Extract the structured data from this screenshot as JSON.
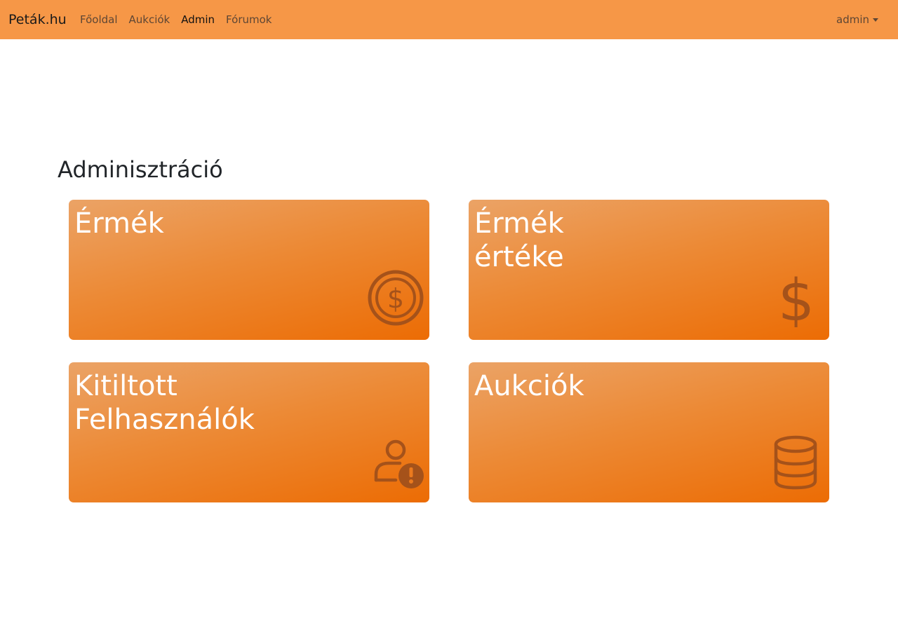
{
  "navbar": {
    "brand": "Peták.hu",
    "links": [
      {
        "label": "Főoldal",
        "active": false
      },
      {
        "label": "Aukciók",
        "active": false
      },
      {
        "label": "Admin",
        "active": true
      },
      {
        "label": "Fórumok",
        "active": false
      }
    ],
    "user": "admin"
  },
  "page": {
    "title": "Adminisztráció"
  },
  "cards": [
    {
      "title": "Érmék",
      "icon": "coin-icon"
    },
    {
      "title": "Érmék\nértéke",
      "icon": "dollar-icon"
    },
    {
      "title": "Kitiltott\nFelhasználók",
      "icon": "user-warning-icon"
    },
    {
      "title": "Aukciók",
      "icon": "database-icon"
    }
  ],
  "colors": {
    "navbar_bg": "#f69747",
    "card_gradient_start": "#eba366",
    "card_gradient_end": "#ec6c04",
    "icon_color": "#a5521a"
  }
}
